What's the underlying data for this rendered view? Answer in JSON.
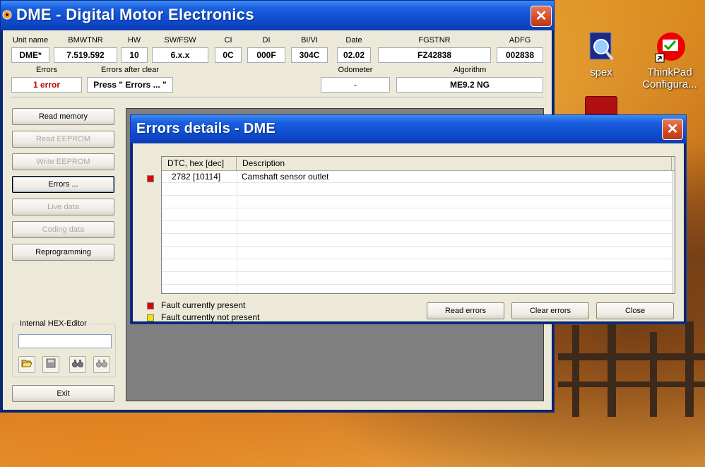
{
  "desktop": {
    "icons": [
      {
        "label": "spex"
      },
      {
        "label": "ThinkPad Configura..."
      }
    ]
  },
  "main_window": {
    "title": "DME - Digital Motor Electronics",
    "close_glyph": "✕",
    "fields_row1": [
      {
        "label": "Unit name",
        "value": "DME*"
      },
      {
        "label": "BMWTNR",
        "value": "7.519.592"
      },
      {
        "label": "HW",
        "value": "10"
      },
      {
        "label": "SW/FSW",
        "value": "6.x.x"
      },
      {
        "label": "CI",
        "value": "0C"
      },
      {
        "label": "DI",
        "value": "000F"
      },
      {
        "label": "BI/VI",
        "value": "304C"
      },
      {
        "label": "Date",
        "value": "02.02"
      },
      {
        "label": "FGSTNR",
        "value": "FZ42838"
      },
      {
        "label": "ADFG",
        "value": "002838"
      }
    ],
    "fields_row2": [
      {
        "label": "Errors",
        "value": "1 error"
      },
      {
        "label": "Errors after clear",
        "value": "Press \" Errors ... \""
      },
      {
        "label": "Odometer",
        "value": "-"
      },
      {
        "label": "Algorithm",
        "value": "ME9.2 NG"
      }
    ],
    "buttons": [
      {
        "label": "Read memory",
        "enabled": true
      },
      {
        "label": "Read EEPROM",
        "enabled": false
      },
      {
        "label": "Write EEPROM",
        "enabled": false
      },
      {
        "label": "Errors ...",
        "enabled": true
      },
      {
        "label": "Live data",
        "enabled": false
      },
      {
        "label": "Coding data",
        "enabled": false
      },
      {
        "label": "Reprogramming",
        "enabled": true
      }
    ],
    "hex_editor": {
      "label": "Internal HEX-Editor",
      "value": ""
    },
    "exit_label": "Exit"
  },
  "errors_dialog": {
    "title": "Errors details - DME",
    "columns": [
      "DTC, hex [dec]",
      "Description"
    ],
    "rows": [
      {
        "status_color": "#e00000",
        "dtc": "2782 [10114]",
        "description": "Camshaft sensor outlet"
      }
    ],
    "legend": [
      {
        "color": "#e00000",
        "text": "Fault currently present"
      },
      {
        "color": "#f5e400",
        "text": "Fault currently not present"
      }
    ],
    "buttons": {
      "read": "Read errors",
      "clear": "Clear errors",
      "close": "Close"
    }
  }
}
